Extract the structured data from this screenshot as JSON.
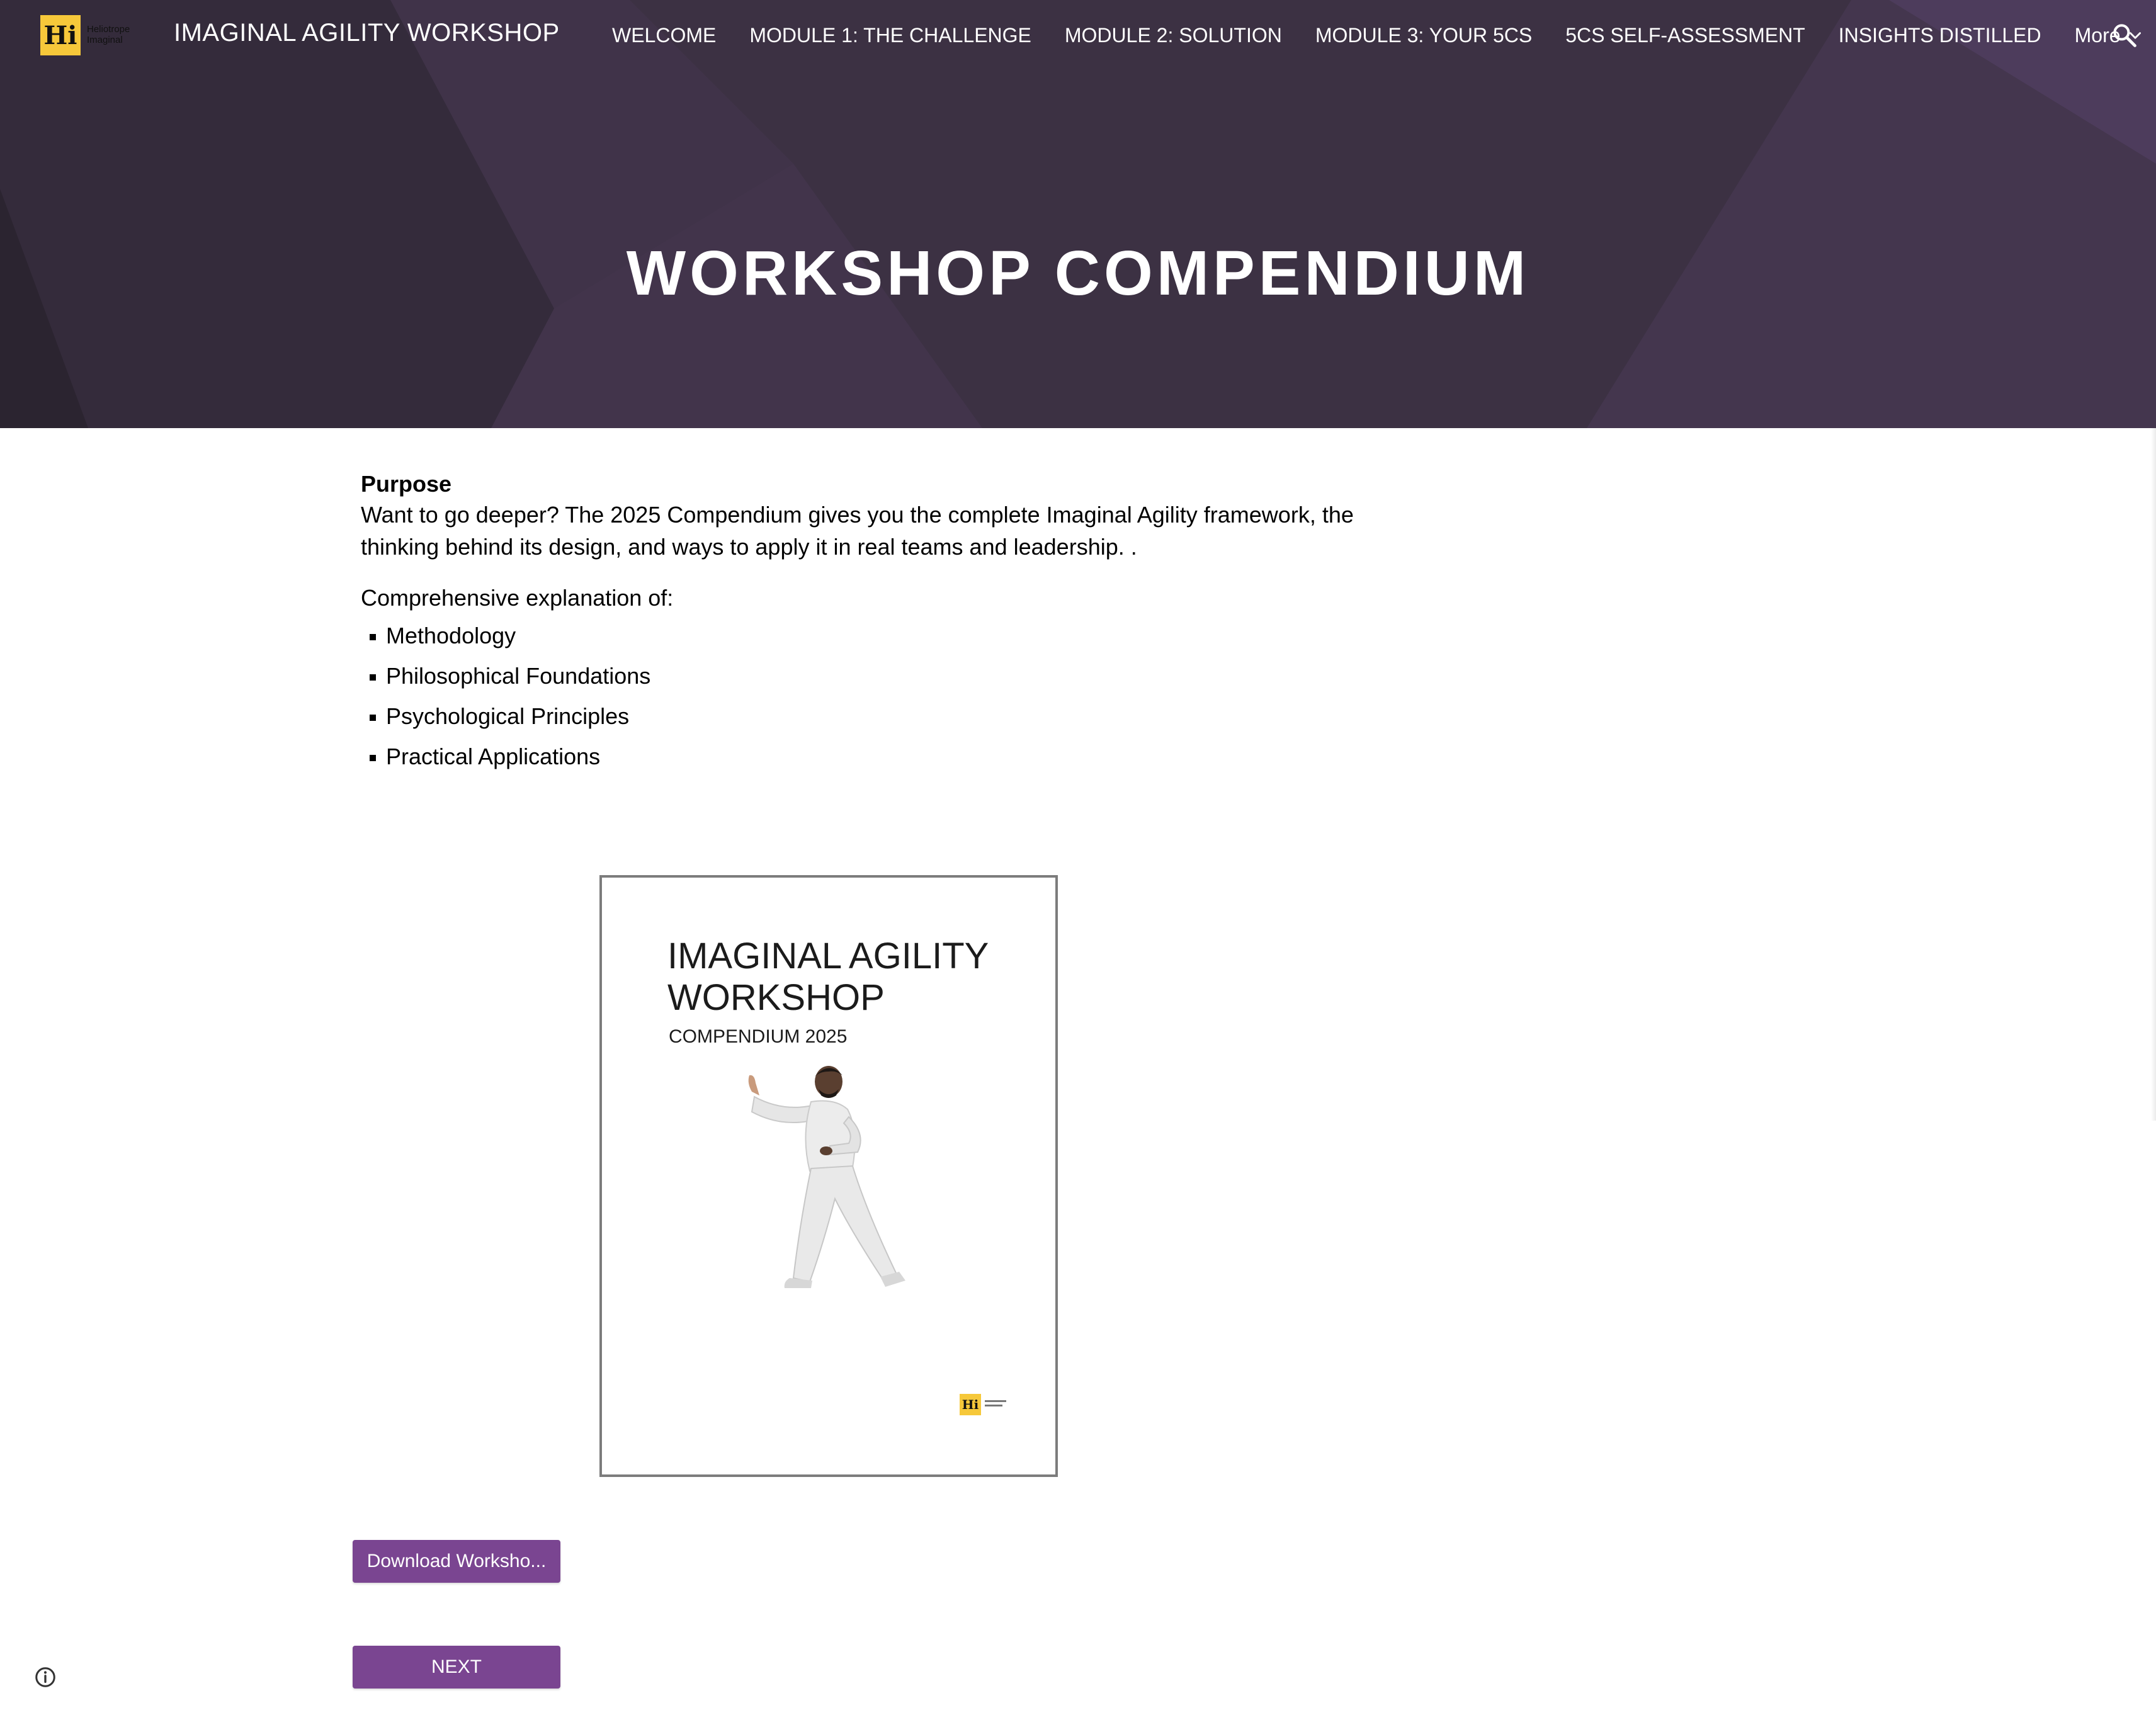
{
  "colors": {
    "hero_bg": "#3c3143",
    "accent_button": "#7a4591",
    "logo_yellow": "#f6c83a",
    "text": "#000000"
  },
  "header": {
    "logo_mark": "Hi",
    "logo_subtext": "Heliotrope\nImaginal",
    "site_title": "IMAGINAL AGILITY WORKSHOP",
    "nav": [
      {
        "label": "WELCOME"
      },
      {
        "label": "MODULE 1: THE CHALLENGE"
      },
      {
        "label": "MODULE 2: SOLUTION"
      },
      {
        "label": "MODULE 3: YOUR 5CS"
      },
      {
        "label": "5CS SELF-ASSESSMENT"
      },
      {
        "label": "INSIGHTS DISTILLED"
      }
    ],
    "more_label": "More",
    "more_icon": "chevron-down-icon",
    "search_icon": "search-icon"
  },
  "hero": {
    "title": "WORKSHOP COMPENDIUM"
  },
  "main": {
    "purpose_heading": "Purpose",
    "purpose_text": "Want to go deeper? The 2025 Compendium gives you the complete Imaginal Agility framework, the thinking behind its design, and ways to apply it in real teams and leadership. .",
    "intro": "Comprehensive explanation of:",
    "topics": [
      "Methodology",
      "Philosophical Foundations",
      "Psychological Principles",
      "Practical Applications"
    ]
  },
  "cover": {
    "title": "IMAGINAL AGILITY\nWORKSHOP",
    "subtitle": "COMPENDIUM 2025",
    "logo_mark": "Hi"
  },
  "buttons": {
    "download_label": "Download Worksho...",
    "next_label": "NEXT"
  },
  "footer": {
    "info_icon": "info-icon"
  }
}
